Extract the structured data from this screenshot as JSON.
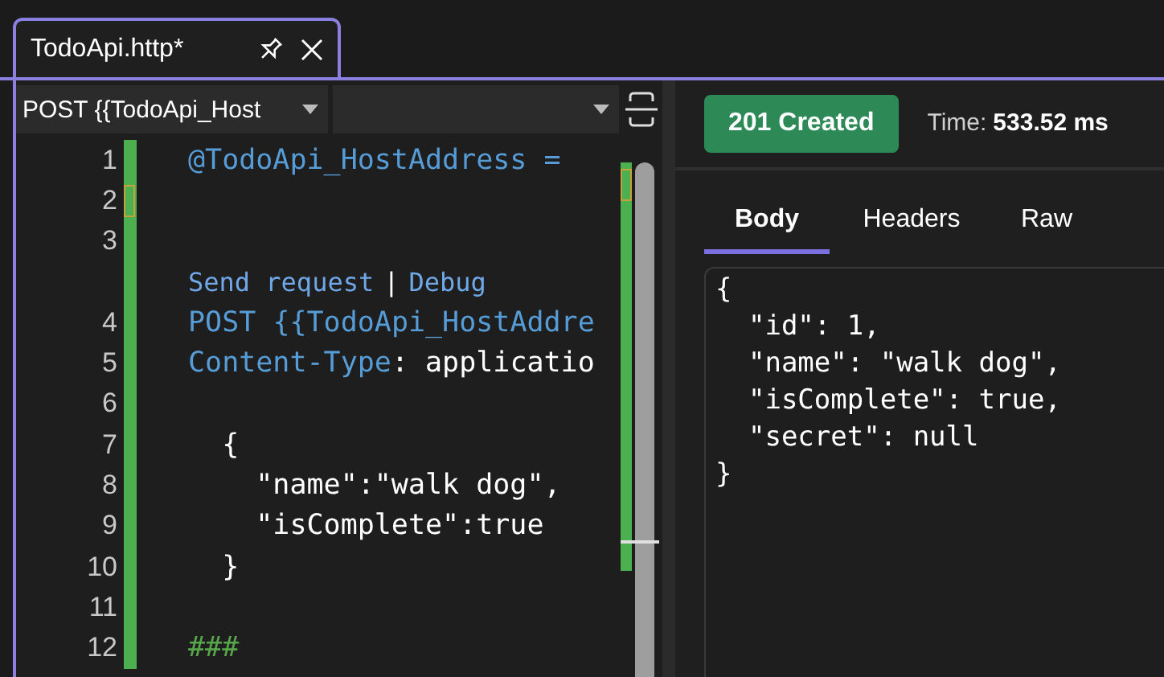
{
  "tab": {
    "title": "TodoApi.http*",
    "pinned": false
  },
  "request_selector": {
    "value": "POST {{TodoApi_Host"
  },
  "editor": {
    "lines": [
      {
        "number": "1",
        "current": false,
        "tokens": [
          {
            "text": "@TodoApi_HostAddress = ",
            "kind": "variable"
          }
        ]
      },
      {
        "number": "2",
        "current": true
      },
      {
        "number": "3",
        "current": false
      },
      {
        "kind": "codelens",
        "actions": [
          "Send request",
          "Debug"
        ],
        "separator": "|"
      },
      {
        "number": "4",
        "current": false,
        "tokens": [
          {
            "text": "POST ",
            "kind": "variable"
          },
          {
            "text": "{{TodoApi_HostAddre",
            "kind": "variable"
          }
        ]
      },
      {
        "number": "5",
        "current": false,
        "tokens": [
          {
            "text": "Content-Type",
            "kind": "variable"
          },
          {
            "text": ": applicatio",
            "kind": "plain"
          }
        ]
      },
      {
        "number": "6",
        "current": false
      },
      {
        "number": "7",
        "current": false,
        "tokens": [
          {
            "text": "  {",
            "kind": "plain"
          }
        ]
      },
      {
        "number": "8",
        "current": false,
        "tokens": [
          {
            "text": "    \"name\":\"walk dog\",",
            "kind": "plain"
          }
        ]
      },
      {
        "number": "9",
        "current": false,
        "tokens": [
          {
            "text": "    \"isComplete\":true",
            "kind": "plain"
          }
        ]
      },
      {
        "number": "10",
        "current": false,
        "tokens": [
          {
            "text": "  }",
            "kind": "plain"
          }
        ]
      },
      {
        "number": "11",
        "current": false
      },
      {
        "number": "12",
        "current": false,
        "tokens": [
          {
            "text": "###",
            "kind": "comment"
          }
        ]
      }
    ]
  },
  "response": {
    "status": "201 Created",
    "time_label": "Time:",
    "time_value": "533.52 ms",
    "tabs": [
      {
        "label": "Body",
        "selected": true
      },
      {
        "label": "Headers",
        "selected": false
      },
      {
        "label": "Raw",
        "selected": false
      }
    ],
    "body_lines": [
      "{",
      "  \"id\": 1,",
      "  \"name\": \"walk dog\",",
      "  \"isComplete\": true,",
      "  \"secret\": null",
      "}"
    ]
  }
}
